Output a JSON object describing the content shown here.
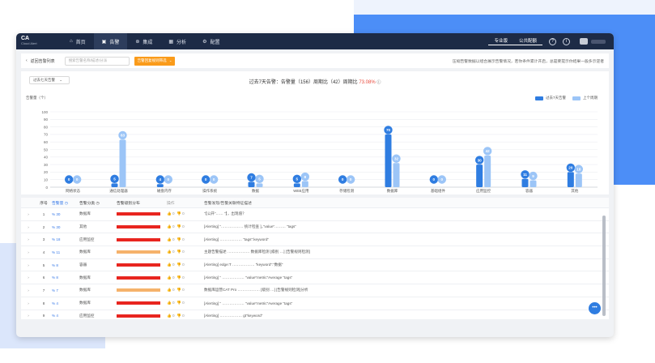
{
  "app": {
    "logo_line1": "CA",
    "logo_line2": "Cloud Alert"
  },
  "nav": {
    "items": [
      {
        "label": "首页",
        "icon": "home-icon"
      },
      {
        "label": "告警",
        "icon": "briefcase-icon"
      },
      {
        "label": "集成",
        "icon": "integration-icon"
      },
      {
        "label": "分析",
        "icon": "grid-icon"
      },
      {
        "label": "配置",
        "icon": "gear-icon"
      }
    ],
    "active_index": 1,
    "right": {
      "pro_label": "专业版",
      "public_label": "公共配额",
      "help_icon": "help-circle-icon",
      "info_icon": "info-circle-icon"
    }
  },
  "toolbar": {
    "back_label": "返回告警列表",
    "search_placeholder": "搜索告警名称/描述/分派",
    "filter_label": "告警回复规则筛选",
    "tip": "压缩告警数据以组合展示告警情况，若你条件累计开启，总是要提示你结果一般多示逆者"
  },
  "chart": {
    "range_label": "过去七天告警",
    "summary_prefix": "过去7天告警：告警量（",
    "summary_total": "156",
    "summary_mid": "）周期比（",
    "summary_prev": "42",
    "summary_suffix": "）周期比",
    "summary_change": "73.08%",
    "ylabel": "告警量（个）"
  },
  "chart_data": {
    "type": "bar",
    "categories": [
      "网络状态",
      "通信处理器",
      "磁盘内存",
      "操作系统",
      "数据",
      "WEB应用",
      "存储检测",
      "数据库",
      "基础组件",
      "应用监控",
      "容器",
      "其他"
    ],
    "series": [
      {
        "name": "过去7天告警",
        "color": "#2f7de1",
        "values": [
          0,
          5,
          4,
          0,
          7,
          5,
          0,
          70,
          0,
          30,
          11,
          20
        ]
      },
      {
        "name": "上个周期",
        "color": "#9cc5f7",
        "values": [
          0,
          63,
          0,
          0,
          5,
          8,
          0,
          32,
          0,
          42,
          9,
          18
        ]
      }
    ],
    "ylim": [
      0,
      100
    ],
    "yticks": [
      0,
      10,
      20,
      30,
      40,
      50,
      60,
      70,
      80,
      90,
      100
    ],
    "grid": true,
    "legend": "top-right"
  },
  "table": {
    "headers": [
      "序号",
      "告警量",
      "告警分类",
      "告警级别分布",
      "操作",
      "告警发现/告警关联特征描述"
    ],
    "rows": [
      {
        "no": "1",
        "count": "% 30",
        "cat": "数据库",
        "level": "#e8251f",
        "likes": "0",
        "dislikes": "0",
        "desc": "“【公开“…… ”】，出现值？"
      },
      {
        "no": "2",
        "count": "% 30",
        "cat": "其他",
        "level": "#e8251f",
        "likes": "0",
        "dislikes": "0",
        "desc": "[Alerting] “……………… 统计检查 ]，”value”……… ”tags”"
      },
      {
        "no": "3",
        "count": "% 18",
        "cat": "应用监控",
        "level": "#e8251f",
        "likes": "0",
        "dislikes": "0",
        "desc": "[Alerting] ……………… ”tags”:keyword”"
      },
      {
        "no": "4",
        "count": "% 11",
        "cat": "数据库",
        "level": "#f5b26b",
        "likes": "0",
        "dislikes": "0",
        "desc": "主题告警描述 ……………… 数据库检测 [级别 …] [告警规则检测]"
      },
      {
        "no": "5",
        "count": "% 8",
        "cat": "容器",
        "level": "#e8251f",
        "likes": "0",
        "dislikes": "0",
        "desc": "[Alerting] edge:T ……………… ”keyword”:”数据”"
      },
      {
        "no": "6",
        "count": "% 8",
        "cat": "数据库",
        "level": "#e8251f",
        "likes": "0",
        "dislikes": "0",
        "desc": "[Alerting] “ ……………… ”value”metric”Average ”tags”"
      },
      {
        "no": "7",
        "count": "% 7",
        "cat": "数据库",
        "level": "#f5b26b",
        "likes": "0",
        "dislikes": "0",
        "desc": "数据库运营CAT Pro ……………… [级别 …] [告警规则检测]分析"
      },
      {
        "no": "8",
        "count": "% 4",
        "cat": "数据库",
        "level": "#e8251f",
        "likes": "0",
        "dislikes": "0",
        "desc": "[Alerting] “ ……………… ”value”metric”Average ”tags”"
      },
      {
        "no": "9",
        "count": "% 4",
        "cat": "应用监控",
        "level": "#e8251f",
        "likes": "0",
        "dislikes": "0",
        "desc": "[Alerting] ……………… gt”keyword”"
      }
    ]
  },
  "chat_icon": "chat-bubble-icon"
}
